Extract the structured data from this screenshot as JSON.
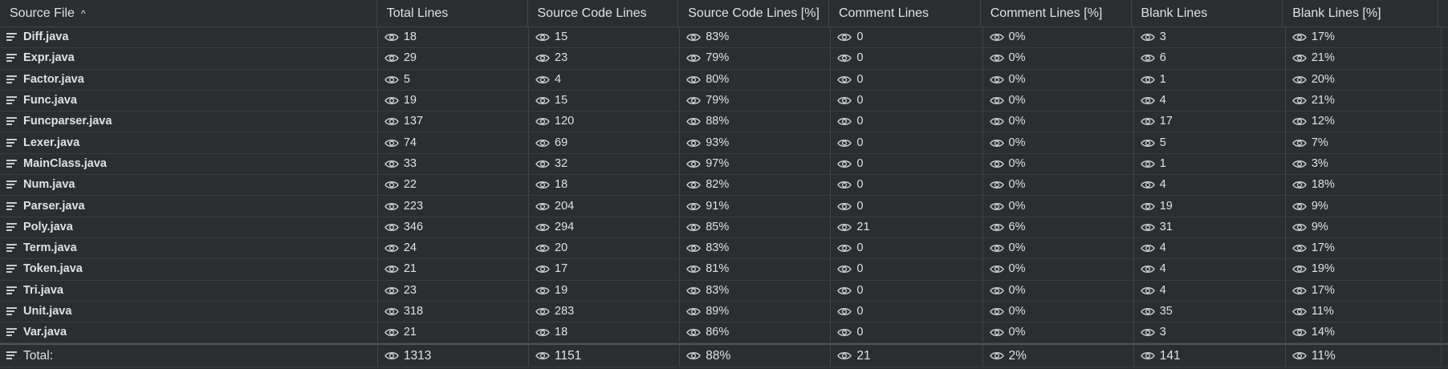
{
  "columns": [
    {
      "label": "Source File",
      "sort_indicator": "^"
    },
    {
      "label": "Total Lines"
    },
    {
      "label": "Source Code Lines"
    },
    {
      "label": "Source Code Lines [%]"
    },
    {
      "label": "Comment Lines"
    },
    {
      "label": "Comment Lines [%]"
    },
    {
      "label": "Blank Lines"
    },
    {
      "label": "Blank Lines [%]"
    }
  ],
  "rows": [
    {
      "file": "Diff.java",
      "total": "18",
      "code": "15",
      "code_pct": "83%",
      "comment": "0",
      "comment_pct": "0%",
      "blank": "3",
      "blank_pct": "17%"
    },
    {
      "file": "Expr.java",
      "total": "29",
      "code": "23",
      "code_pct": "79%",
      "comment": "0",
      "comment_pct": "0%",
      "blank": "6",
      "blank_pct": "21%"
    },
    {
      "file": "Factor.java",
      "total": "5",
      "code": "4",
      "code_pct": "80%",
      "comment": "0",
      "comment_pct": "0%",
      "blank": "1",
      "blank_pct": "20%"
    },
    {
      "file": "Func.java",
      "total": "19",
      "code": "15",
      "code_pct": "79%",
      "comment": "0",
      "comment_pct": "0%",
      "blank": "4",
      "blank_pct": "21%"
    },
    {
      "file": "Funcparser.java",
      "total": "137",
      "code": "120",
      "code_pct": "88%",
      "comment": "0",
      "comment_pct": "0%",
      "blank": "17",
      "blank_pct": "12%"
    },
    {
      "file": "Lexer.java",
      "total": "74",
      "code": "69",
      "code_pct": "93%",
      "comment": "0",
      "comment_pct": "0%",
      "blank": "5",
      "blank_pct": "7%"
    },
    {
      "file": "MainClass.java",
      "total": "33",
      "code": "32",
      "code_pct": "97%",
      "comment": "0",
      "comment_pct": "0%",
      "blank": "1",
      "blank_pct": "3%"
    },
    {
      "file": "Num.java",
      "total": "22",
      "code": "18",
      "code_pct": "82%",
      "comment": "0",
      "comment_pct": "0%",
      "blank": "4",
      "blank_pct": "18%"
    },
    {
      "file": "Parser.java",
      "total": "223",
      "code": "204",
      "code_pct": "91%",
      "comment": "0",
      "comment_pct": "0%",
      "blank": "19",
      "blank_pct": "9%"
    },
    {
      "file": "Poly.java",
      "total": "346",
      "code": "294",
      "code_pct": "85%",
      "comment": "21",
      "comment_pct": "6%",
      "blank": "31",
      "blank_pct": "9%"
    },
    {
      "file": "Term.java",
      "total": "24",
      "code": "20",
      "code_pct": "83%",
      "comment": "0",
      "comment_pct": "0%",
      "blank": "4",
      "blank_pct": "17%"
    },
    {
      "file": "Token.java",
      "total": "21",
      "code": "17",
      "code_pct": "81%",
      "comment": "0",
      "comment_pct": "0%",
      "blank": "4",
      "blank_pct": "19%"
    },
    {
      "file": "Tri.java",
      "total": "23",
      "code": "19",
      "code_pct": "83%",
      "comment": "0",
      "comment_pct": "0%",
      "blank": "4",
      "blank_pct": "17%"
    },
    {
      "file": "Unit.java",
      "total": "318",
      "code": "283",
      "code_pct": "89%",
      "comment": "0",
      "comment_pct": "0%",
      "blank": "35",
      "blank_pct": "11%"
    },
    {
      "file": "Var.java",
      "total": "21",
      "code": "18",
      "code_pct": "86%",
      "comment": "0",
      "comment_pct": "0%",
      "blank": "3",
      "blank_pct": "14%"
    }
  ],
  "totals": {
    "label": "Total:",
    "total": "1313",
    "code": "1151",
    "code_pct": "88%",
    "comment": "21",
    "comment_pct": "2%",
    "blank": "141",
    "blank_pct": "11%"
  },
  "icons": {
    "row_icon": "lines-icon",
    "value_icon": "eye-icon"
  },
  "colors": {
    "background": "#2b2d30",
    "text": "#dfe1e5",
    "grid": "#43454a"
  }
}
